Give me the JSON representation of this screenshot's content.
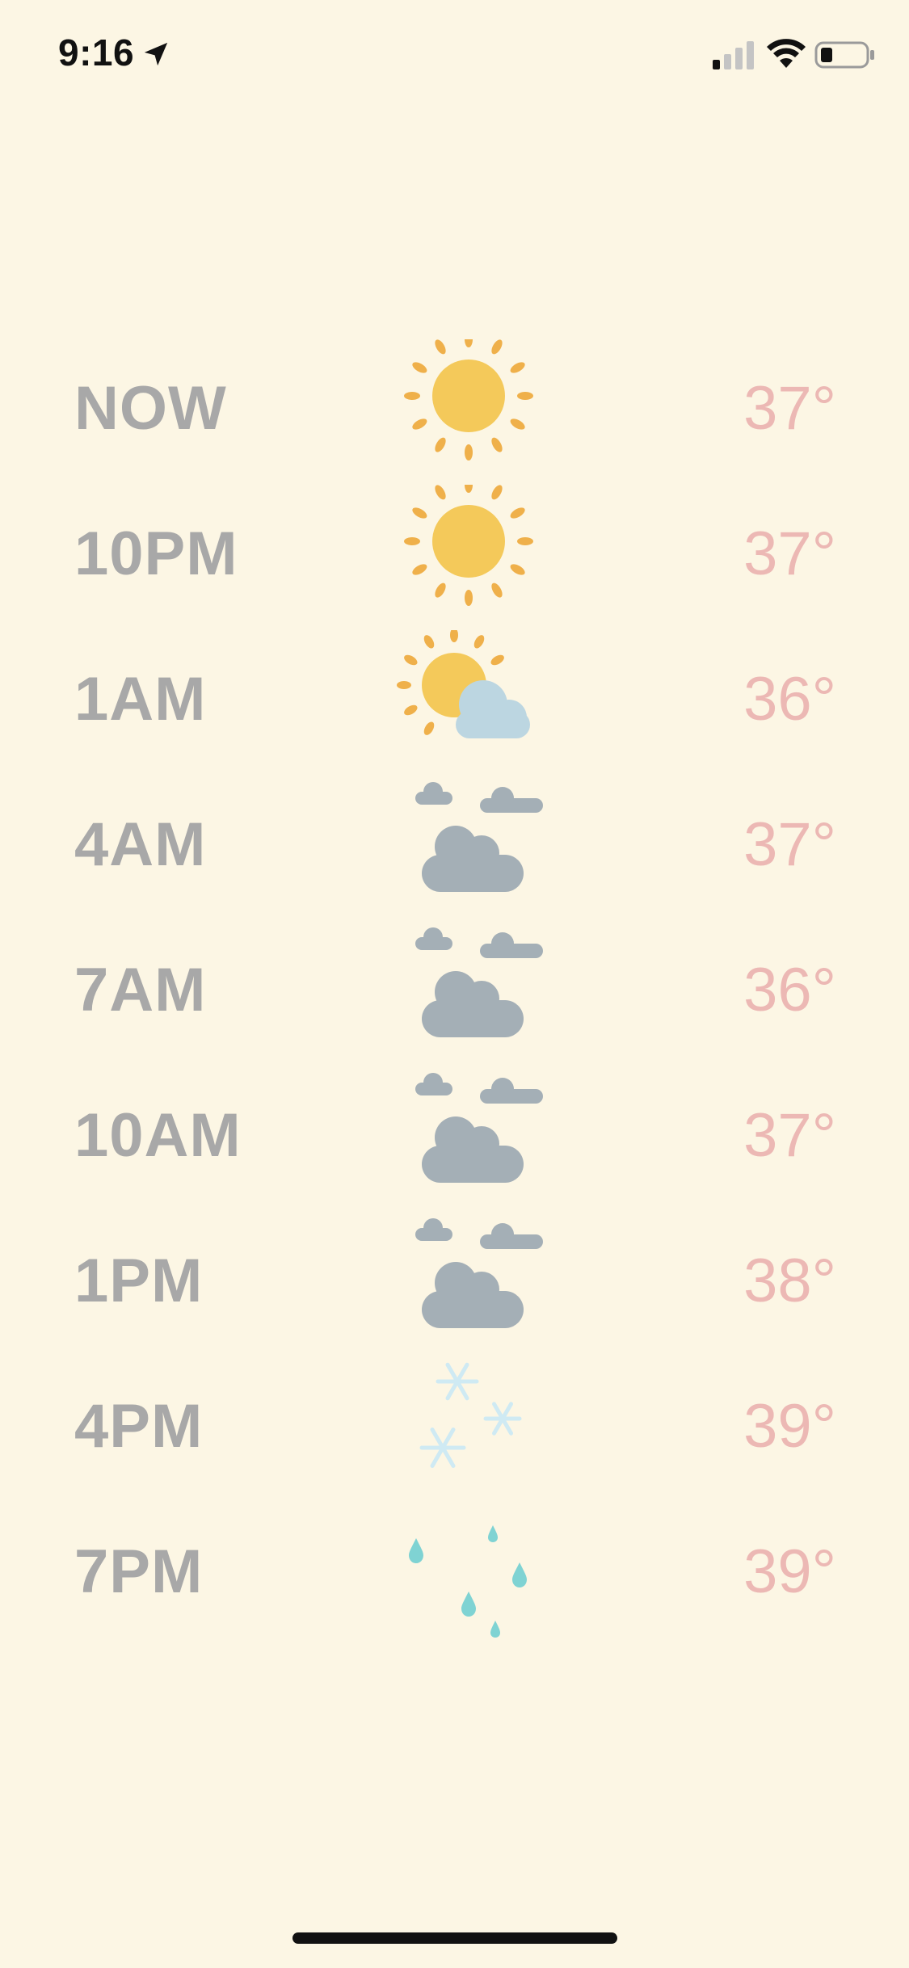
{
  "status_bar": {
    "time": "9:16",
    "icons": [
      "location-arrow-icon",
      "cellular-signal-icon",
      "wifi-icon",
      "battery-icon"
    ]
  },
  "forecast": [
    {
      "time": "NOW",
      "condition": "sunny",
      "temp": "37°"
    },
    {
      "time": "10PM",
      "condition": "sunny",
      "temp": "37°"
    },
    {
      "time": "1AM",
      "condition": "partly-cloudy",
      "temp": "36°"
    },
    {
      "time": "4AM",
      "condition": "cloudy",
      "temp": "37°"
    },
    {
      "time": "7AM",
      "condition": "cloudy",
      "temp": "36°"
    },
    {
      "time": "10AM",
      "condition": "cloudy",
      "temp": "37°"
    },
    {
      "time": "1PM",
      "condition": "cloudy",
      "temp": "38°"
    },
    {
      "time": "4PM",
      "condition": "snow",
      "temp": "39°"
    },
    {
      "time": "7PM",
      "condition": "rain",
      "temp": "39°"
    }
  ],
  "colors": {
    "background": "#fcf6e4",
    "time_text": "#a8a8a8",
    "temp_text": "#ecb8b4",
    "sun": "#f4c95a",
    "sun_ray": "#efb04a",
    "cloud_grey": "#a4afb6",
    "cloud_light": "#bcd6e1",
    "snow": "#cfeaf3",
    "rain": "#7fd3d3"
  }
}
